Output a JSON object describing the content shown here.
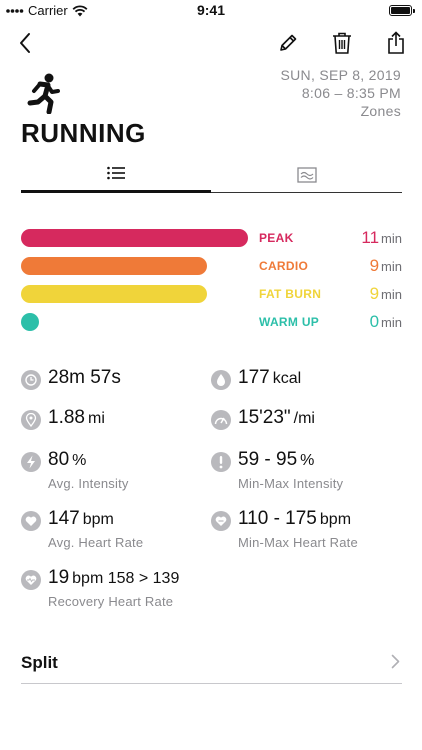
{
  "status_bar": {
    "carrier": "Carrier",
    "time": "9:41"
  },
  "nav": {
    "back_icon": "chevron-left-icon",
    "edit_icon": "pencil-icon",
    "delete_icon": "trash-icon",
    "share_icon": "share-icon"
  },
  "activity": {
    "icon": "running-person-icon",
    "title": "RUNNING",
    "date": "SUN, SEP 8, 2019",
    "time_range": "8:06 – 8:35 PM",
    "view_label": "Zones"
  },
  "tabs": [
    {
      "icon": "list-icon",
      "active": true
    },
    {
      "icon": "chart-icon",
      "active": false
    }
  ],
  "zones": [
    {
      "label": "PEAK",
      "minutes": "11",
      "unit": "min",
      "color": "#d6295e",
      "fraction": 1.0
    },
    {
      "label": "CARDIO",
      "minutes": "9",
      "unit": "min",
      "color": "#ef7a38",
      "fraction": 0.82
    },
    {
      "label": "FAT BURN",
      "minutes": "9",
      "unit": "min",
      "color": "#f0d43a",
      "fraction": 0.82
    },
    {
      "label": "WARM UP",
      "minutes": "0",
      "unit": "min",
      "color": "#2cbfa9",
      "fraction": 0
    }
  ],
  "stats": {
    "duration": {
      "value": "28m 57s"
    },
    "calories": {
      "value": "177",
      "unit": "kcal"
    },
    "distance": {
      "value": "1.88",
      "unit": "mi"
    },
    "pace": {
      "value": "15'23\"",
      "unit": "/mi"
    },
    "avg_intensity": {
      "value": "80",
      "unit": "%",
      "label": "Avg. Intensity"
    },
    "minmax_intensity": {
      "value": "59 - 95",
      "unit": "%",
      "label": "Min-Max Intensity"
    },
    "avg_hr": {
      "value": "147",
      "unit": "bpm",
      "label": "Avg. Heart Rate"
    },
    "minmax_hr": {
      "value": "110 - 175",
      "unit": "bpm",
      "label": "Min-Max Heart Rate"
    },
    "recovery_hr": {
      "value": "19",
      "unit": "bpm 158 > 139",
      "label": "Recovery Heart Rate"
    }
  },
  "split": {
    "label": "Split"
  }
}
